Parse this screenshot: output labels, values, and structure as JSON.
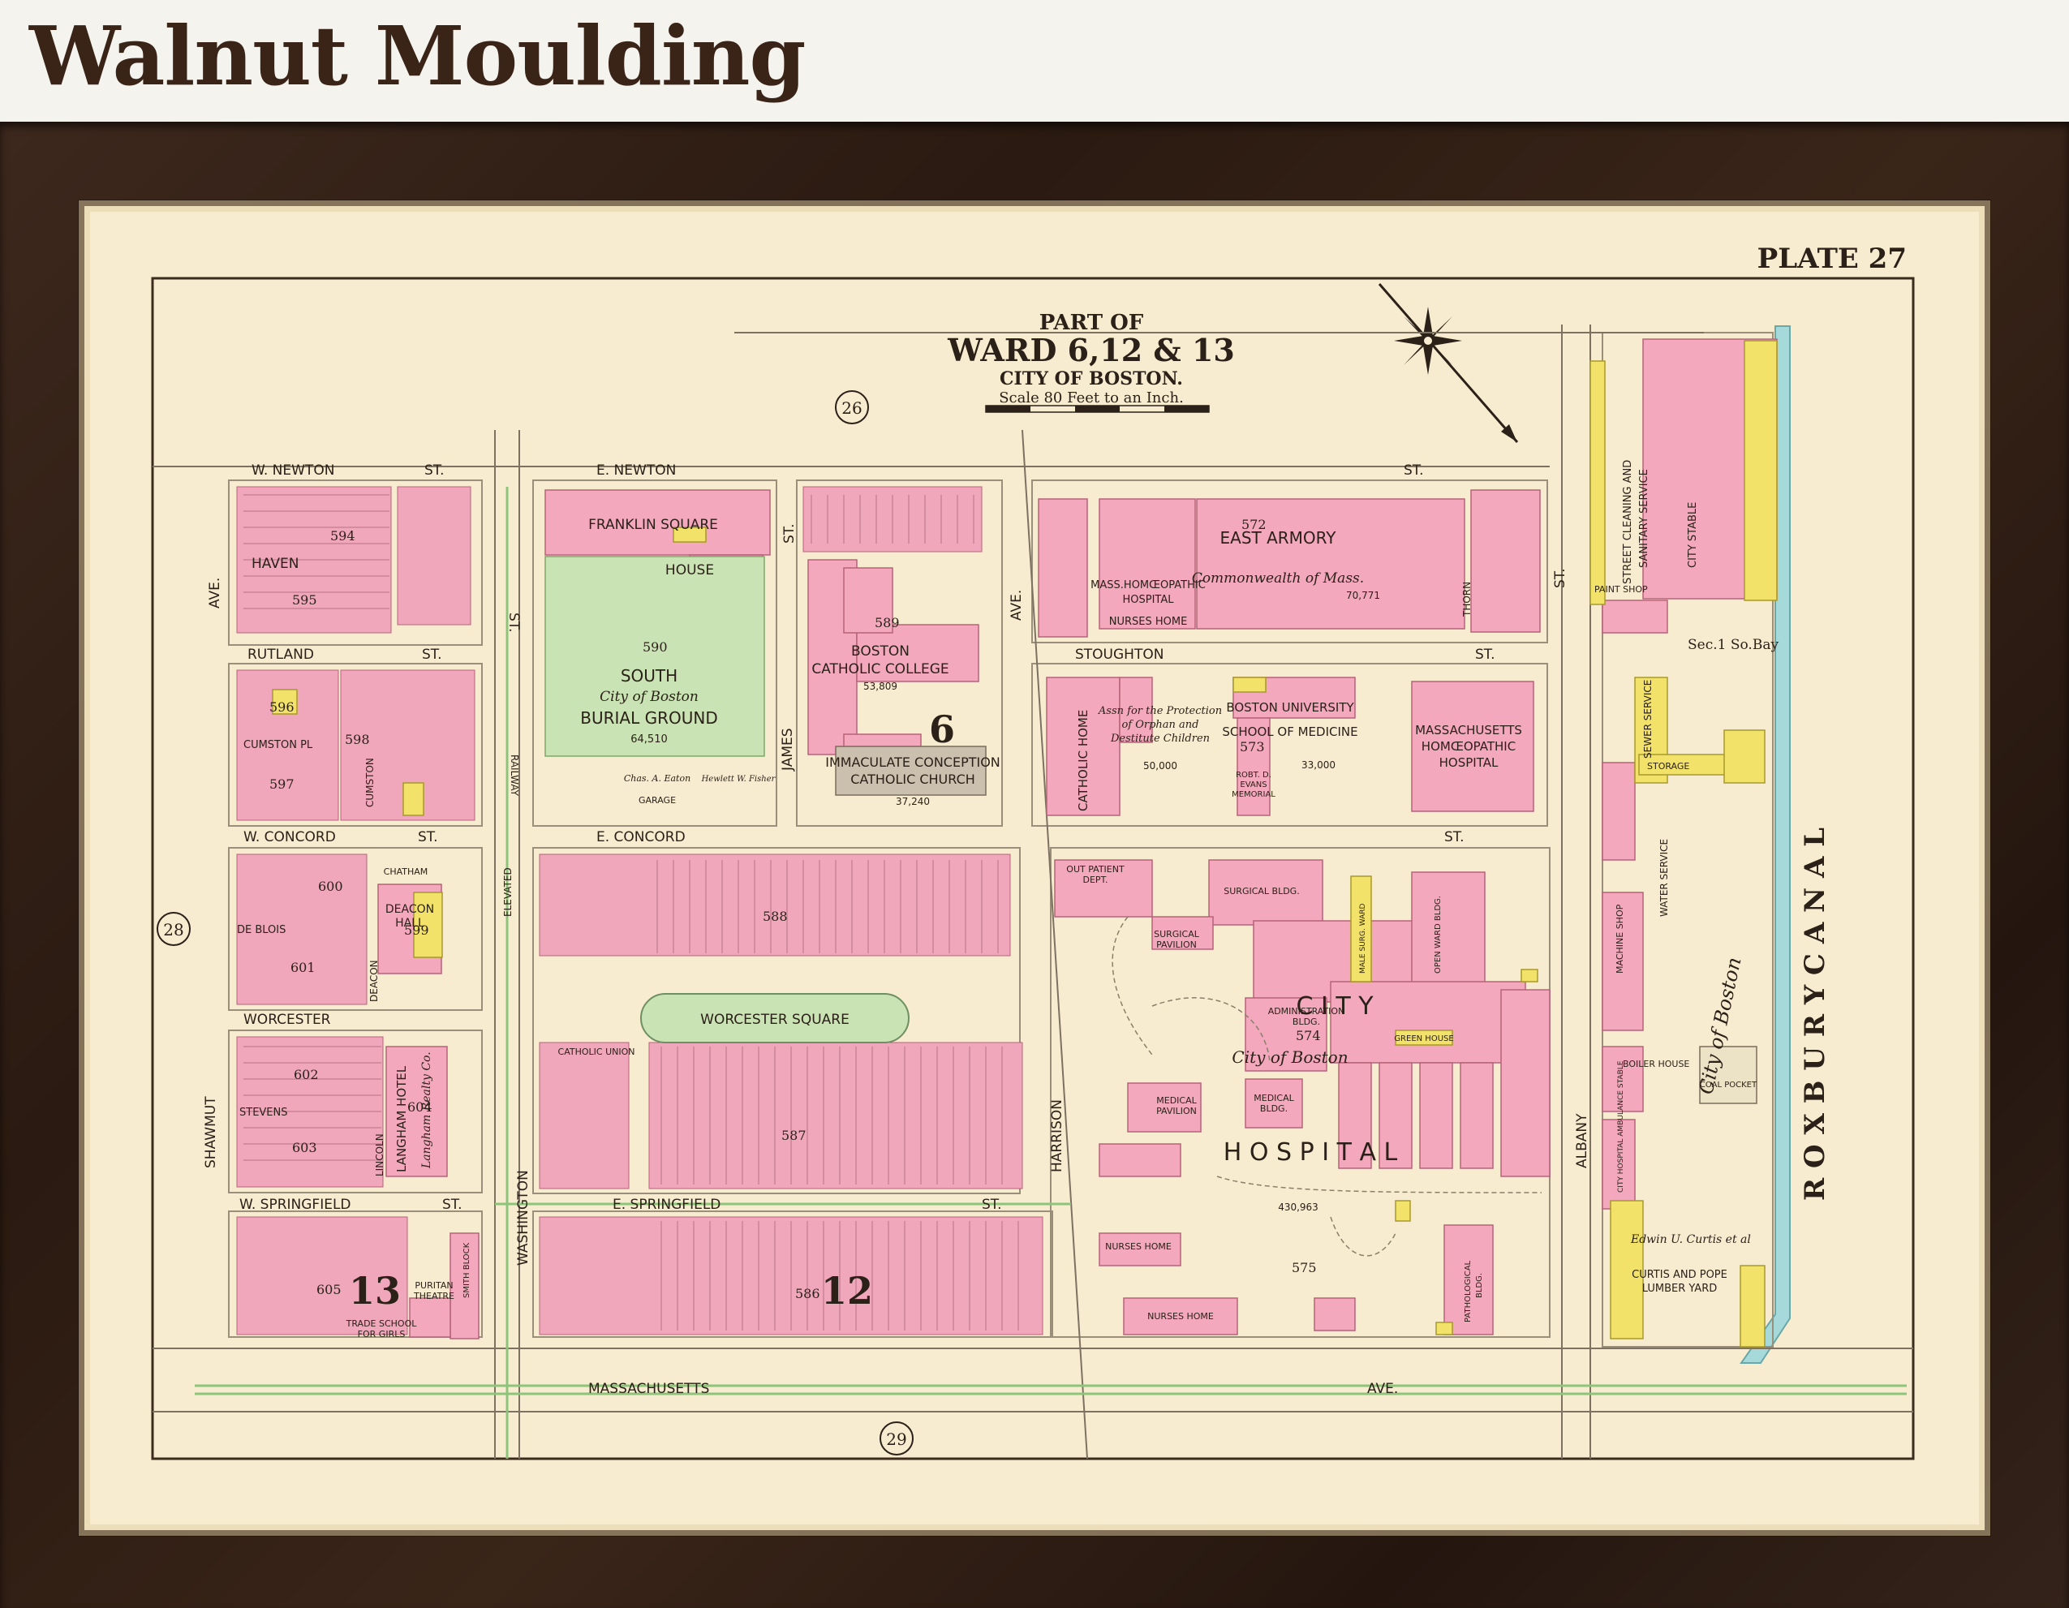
{
  "header": {
    "title": "Walnut Moulding"
  },
  "plate": {
    "label": "PLATE 27",
    "heading_part": "PART OF",
    "heading_ward": "WARD 6,12 & 13",
    "heading_city": "CITY OF BOSTON.",
    "scale": "Scale 80 Feet to an Inch.",
    "adjacent_plates": [
      "26",
      "28",
      "29"
    ]
  },
  "colors": {
    "frame": "#2e1d14",
    "paper": "#f7ecd0",
    "brick": "#f3a8bd",
    "wood": "#f3e36a",
    "park": "#c9e3b4",
    "canal": "#9fd6d8",
    "ink": "#2b2118"
  },
  "streets": {
    "w_newton": "W. NEWTON",
    "e_newton": "E. NEWTON",
    "st": "ST.",
    "haven": "HAVEN",
    "rutland": "RUTLAND",
    "cumston_pl": "CUMSTON PL",
    "cumston": "CUMSTON",
    "w_concord": "W. CONCORD",
    "e_concord": "E. CONCORD",
    "de_blois": "DE BLOIS",
    "worcester": "WORCESTER",
    "worcester_square": "WORCESTER SQUARE",
    "stevens": "STEVENS",
    "w_springfield": "W. SPRINGFIELD",
    "e_springfield": "E. SPRINGFIELD",
    "massachusetts": "MASSACHUSETTS",
    "ave": "AVE.",
    "stoughton": "STOUGHTON",
    "shawmut": "SHAWMUT",
    "washington": "WASHINGTON",
    "harrison": "HARRISON",
    "albany": "ALBANY",
    "james": "JAMES",
    "thorn": "THORN",
    "lincoln": "LINCOLN",
    "deacon": "DEACON",
    "railway": "RAILWAY",
    "elevated": "ELEVATED",
    "roxbury_canal": "R O X B U R Y   C A N A L"
  },
  "blocks": [
    "594",
    "595",
    "596",
    "597",
    "598",
    "599",
    "600",
    "601",
    "602",
    "603",
    "604",
    "605",
    "586",
    "587",
    "588",
    "589",
    "590",
    "572",
    "573",
    "574",
    "575"
  ],
  "ward_numbers": [
    "6",
    "12",
    "13"
  ],
  "labels": {
    "franklin_square": "FRANKLIN SQUARE",
    "house": "HOUSE",
    "south_burial_ground": [
      "SOUTH",
      "City of Boston",
      "BURIAL GROUND"
    ],
    "area_590": "64,510",
    "boston_catholic_college": [
      "BOSTON",
      "CATHOLIC COLLEGE"
    ],
    "area_589": "53,809",
    "immaculate_conception": [
      "IMMACULATE CONCEPTION",
      "CATHOLIC CHURCH"
    ],
    "area_church": "37,240",
    "east_armory": "EAST ARMORY",
    "commonwealth": "Commonwealth of Mass.",
    "area_572": "70,771",
    "mass_homoeopathic_hospital": [
      "MASS.HOMŒOPATHIC",
      "HOSPITAL"
    ],
    "nurses_home": "NURSES HOME",
    "catholic_home": "CATHOLIC HOME",
    "orphan_assn": [
      "Assn for the Protection",
      "of Orphan and",
      "Destitute Children"
    ],
    "area_orphan": "50,000",
    "boston_university": [
      "BOSTON UNIVERSITY",
      "SCHOOL OF MEDICINE"
    ],
    "area_573": "33,000",
    "evans_memorial": [
      "ROBT. D.",
      "EVANS",
      "MEMORIAL"
    ],
    "mass_homoeopathic_2": [
      "MASSACHUSETTS",
      "HOMŒOPATHIC",
      "HOSPITAL"
    ],
    "street_cleaning": [
      "STREET CLEANING AND",
      "SANITARY SERVICE"
    ],
    "city_stable": "CITY STABLE",
    "paint_shop": "PAINT SHOP",
    "sec_1_so_bay": "Sec.1 So.Bay",
    "sewer_service": "SEWER SERVICE",
    "storage": "STORAGE",
    "water_service": "WATER SERVICE",
    "machine_shop": "MACHINE SHOP",
    "boiler_house": "BOILER HOUSE",
    "coal_pocket": "COAL POCKET",
    "ambulance": "CITY HOSPITAL AMBULANCE STABLE",
    "city_of_boston_diag": "City of Boston",
    "edwin_curtis": "Edwin U. Curtis et al",
    "curtis_pope": [
      "CURTIS AND POPE",
      "LUMBER YARD"
    ],
    "out_patient_dept": [
      "OUT PATIENT",
      "DEPT."
    ],
    "surgical_bldg": "SURGICAL BLDG.",
    "surgical_pavilion": [
      "SURGICAL",
      "PAVILION"
    ],
    "male_surg_ward": "MALE SURG. WARD",
    "open_ward_bldg": "OPEN WARD BLDG.",
    "city": "C I T Y",
    "city_of_boston": "City of Boston",
    "administration": [
      "ADMINISTRATION",
      "BLDG."
    ],
    "green_house": "GREEN HOUSE",
    "medical_pavilion": [
      "MEDICAL",
      "PAVILION"
    ],
    "medical_bldg": [
      "MEDICAL",
      "BLDG."
    ],
    "hospital": "H O S P I T A L",
    "area_574": "430,963",
    "nurses_home_2": "NURSES HOME",
    "nurses_home_3": "NURSES HOME",
    "pathological_bldg": [
      "PATHOLOGICAL",
      "BLDG."
    ],
    "chatham": "CHATHAM",
    "deacon_hall": [
      "DEACON",
      "HALL"
    ],
    "langham_hotel": "LANGHAM HOTEL",
    "langham_realty": "Langham Realty Co.",
    "catholic_union": "CATHOLIC UNION",
    "puritan_theatre": [
      "PURITAN",
      "THEATRE"
    ],
    "trade_school": [
      "TRADE SCHOOL",
      "FOR GIRLS"
    ],
    "smith_block": "SMITH BLOCK",
    "garage": "GARAGE",
    "chas_a_eaton": "Chas. A. Eaton",
    "hewlett": "Hewlett W. Fisher"
  }
}
